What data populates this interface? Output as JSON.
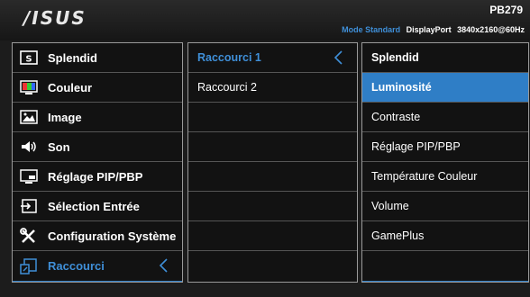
{
  "header": {
    "brand": "/ISUS",
    "model": "PB279",
    "mode": "Mode Standard",
    "connection": "DisplayPort",
    "resolution": "3840x2160@60Hz"
  },
  "main_menu": [
    {
      "label": "Splendid",
      "icon": "splendid-icon"
    },
    {
      "label": "Couleur",
      "icon": "color-icon"
    },
    {
      "label": "Image",
      "icon": "image-icon"
    },
    {
      "label": "Son",
      "icon": "speaker-icon"
    },
    {
      "label": "Réglage PIP/PBP",
      "icon": "pip-icon"
    },
    {
      "label": "Sélection Entrée",
      "icon": "input-icon"
    },
    {
      "label": "Configuration Système",
      "icon": "wrench-icon"
    },
    {
      "label": "Raccourci",
      "icon": "shortcut-icon",
      "selected": true
    }
  ],
  "submenu": [
    {
      "label": "Raccourci 1",
      "selected": true
    },
    {
      "label": "Raccourci 2"
    }
  ],
  "options": [
    {
      "label": "Splendid"
    },
    {
      "label": "Luminosité",
      "highlighted": true
    },
    {
      "label": "Contraste"
    },
    {
      "label": "Réglage PIP/PBP"
    },
    {
      "label": "Température Couleur"
    },
    {
      "label": "Volume"
    },
    {
      "label": "GamePlus"
    }
  ],
  "colors": {
    "accent": "#3f8fd8",
    "highlight": "#2f7ec6",
    "background": "#1c1c1c"
  }
}
